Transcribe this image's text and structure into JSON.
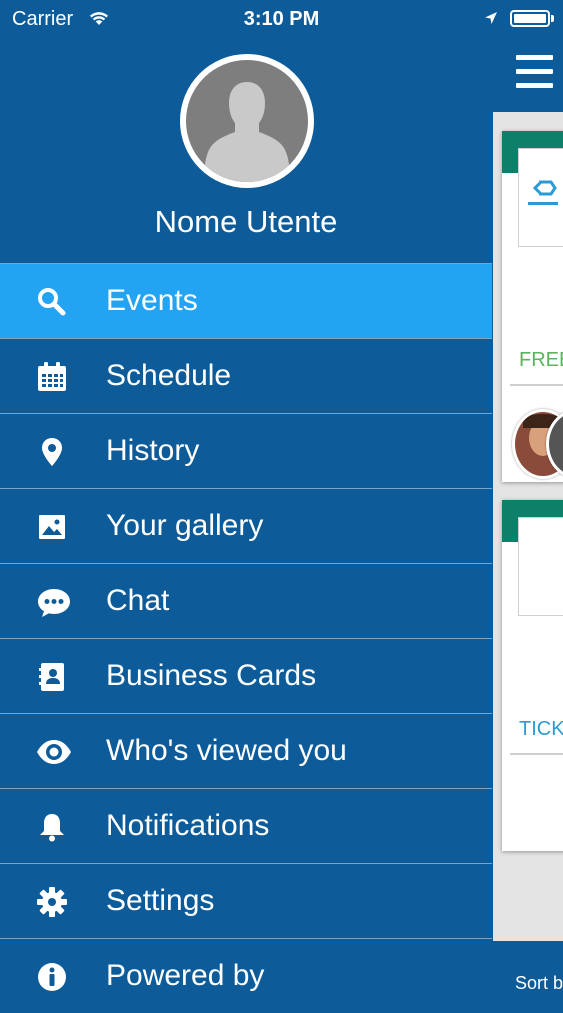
{
  "status_bar": {
    "carrier": "Carrier",
    "time": "3:10 PM"
  },
  "profile": {
    "name": "Nome Utente"
  },
  "menu": {
    "items": [
      {
        "label": "Events",
        "icon": "search-icon",
        "active": true
      },
      {
        "label": "Schedule",
        "icon": "calendar-icon",
        "active": false
      },
      {
        "label": "History",
        "icon": "location-pin-icon",
        "active": false
      },
      {
        "label": "Your gallery",
        "icon": "image-icon",
        "active": false
      },
      {
        "label": "Chat",
        "icon": "chat-bubble-icon",
        "active": false
      },
      {
        "label": "Business Cards",
        "icon": "contacts-book-icon",
        "active": false
      },
      {
        "label": "Who's viewed you",
        "icon": "eye-icon",
        "active": false
      },
      {
        "label": "Notifications",
        "icon": "bell-icon",
        "active": false
      },
      {
        "label": "Settings",
        "icon": "gear-icon",
        "active": false
      },
      {
        "label": "Powered by",
        "icon": "info-icon",
        "active": false
      }
    ]
  },
  "content": {
    "card1_tag": "FREE",
    "card2_tag": "TICK",
    "sort_label": "Sort b"
  },
  "colors": {
    "background": "#0d5c99",
    "active_item": "#23a4f2",
    "card_stripe": "#0e7f69",
    "free_tag": "#5bb55f",
    "ticket_tag": "#2b9bd6"
  }
}
